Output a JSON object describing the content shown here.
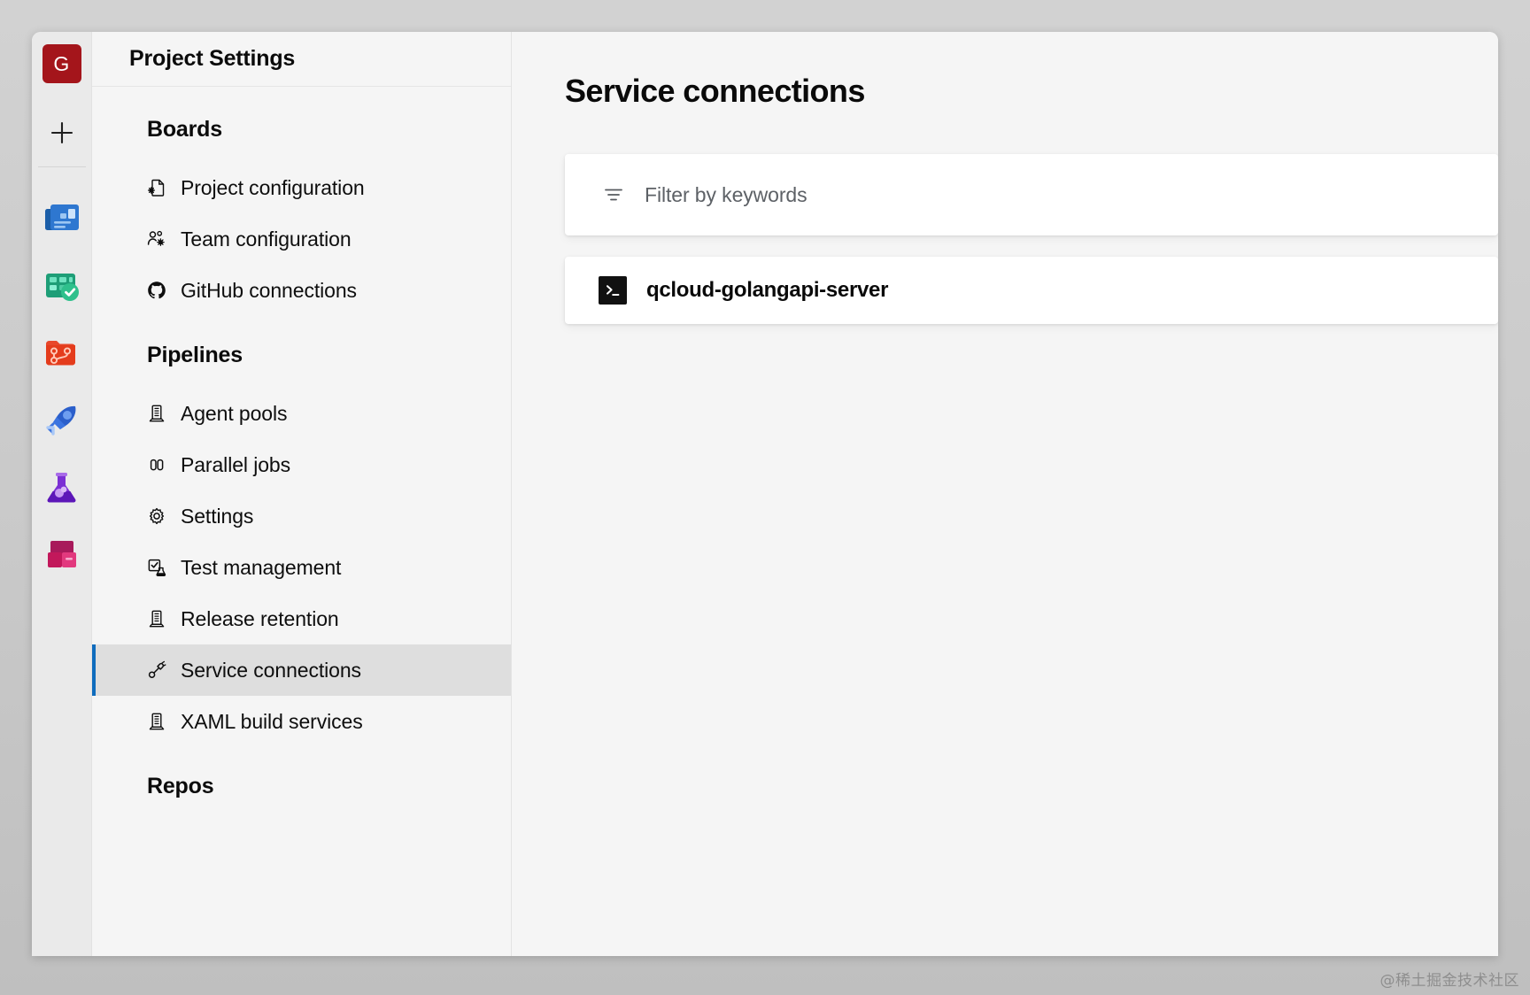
{
  "rail": {
    "avatar_label": "G",
    "add_icon": "plus-icon",
    "items": [
      {
        "name": "overview",
        "icon": "overview-icon"
      },
      {
        "name": "boards",
        "icon": "boards-icon"
      },
      {
        "name": "repos",
        "icon": "repos-icon"
      },
      {
        "name": "pipelines",
        "icon": "pipelines-icon"
      },
      {
        "name": "test-plans",
        "icon": "test-plans-icon"
      },
      {
        "name": "artifacts",
        "icon": "artifacts-icon"
      }
    ]
  },
  "nav": {
    "header_title": "Project Settings",
    "groups": [
      {
        "title": "Boards",
        "items": [
          {
            "label": "Project configuration",
            "icon": "file-gear-icon",
            "selected": false
          },
          {
            "label": "Team configuration",
            "icon": "people-gear-icon",
            "selected": false
          },
          {
            "label": "GitHub connections",
            "icon": "github-icon",
            "selected": false
          }
        ]
      },
      {
        "title": "Pipelines",
        "items": [
          {
            "label": "Agent pools",
            "icon": "server-icon",
            "selected": false
          },
          {
            "label": "Parallel jobs",
            "icon": "parallel-bars-icon",
            "selected": false
          },
          {
            "label": "Settings",
            "icon": "gear-icon",
            "selected": false
          },
          {
            "label": "Test management",
            "icon": "test-beaker-check-icon",
            "selected": false
          },
          {
            "label": "Release retention",
            "icon": "server-icon",
            "selected": false
          },
          {
            "label": "Service connections",
            "icon": "plug-link-icon",
            "selected": true
          },
          {
            "label": "XAML build services",
            "icon": "server-icon",
            "selected": false
          }
        ]
      },
      {
        "title": "Repos",
        "items": []
      }
    ]
  },
  "main": {
    "page_title": "Service connections",
    "filter": {
      "placeholder": "Filter by keywords",
      "value": "",
      "icon": "filter-icon"
    },
    "connections": [
      {
        "name": "qcloud-golangapi-server",
        "icon": "terminal-icon"
      }
    ]
  },
  "watermark": {
    "text": "@稀土掘金技术社区"
  },
  "colors": {
    "accent": "#0f6cbd",
    "avatar_bg": "#a4151b",
    "selected_bg": "#dedede",
    "panel_bg": "#f5f5f5",
    "card_bg": "#ffffff"
  }
}
